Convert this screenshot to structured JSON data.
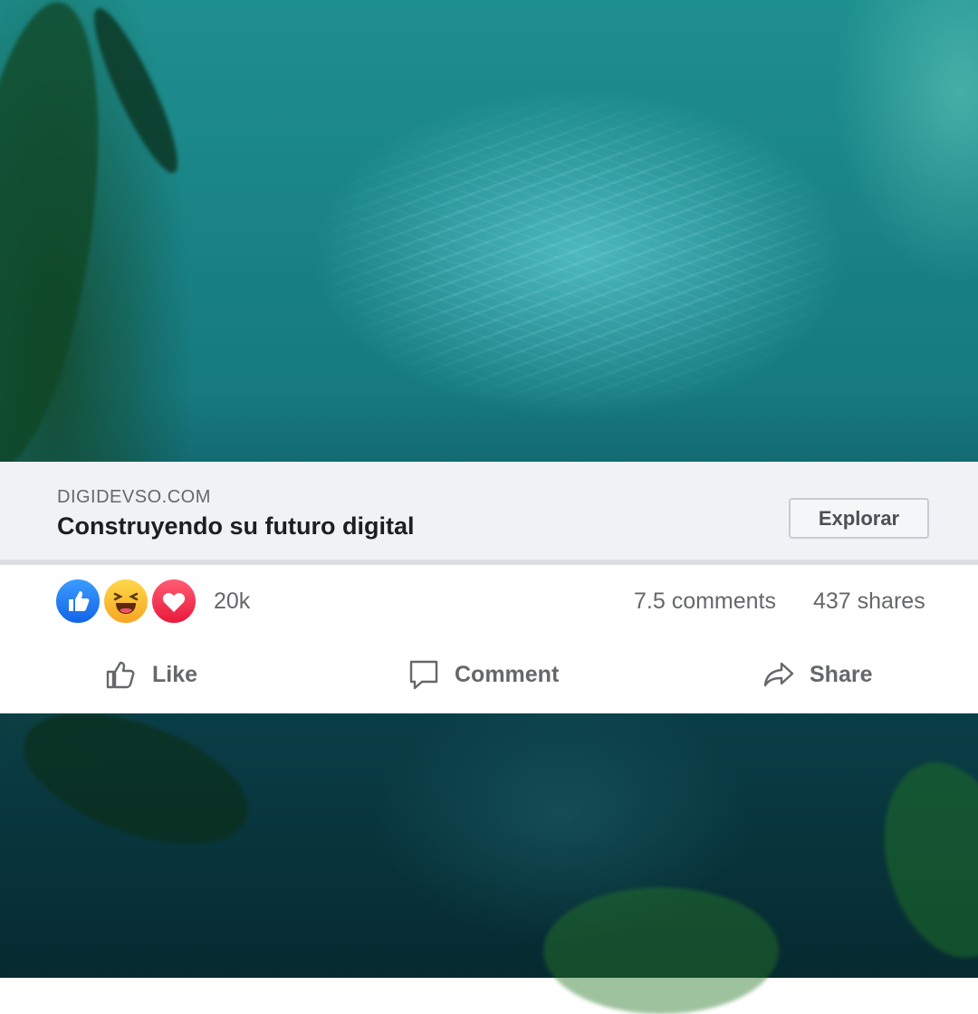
{
  "link_preview": {
    "domain": "DIGIDEVSO.COM",
    "headline": "Construyendo su futuro digital",
    "cta_label": "Explorar"
  },
  "stats": {
    "reactions": [
      "like",
      "haha",
      "love"
    ],
    "reaction_count": "20k",
    "comments": "7.5 comments",
    "shares": "437 shares"
  },
  "actions": {
    "like": "Like",
    "comment": "Comment",
    "share": "Share"
  },
  "colors": {
    "like_blue": "#1877f2",
    "love_red": "#f33e58",
    "haha_yellow": "#f7b125",
    "text_secondary": "#65676b"
  }
}
